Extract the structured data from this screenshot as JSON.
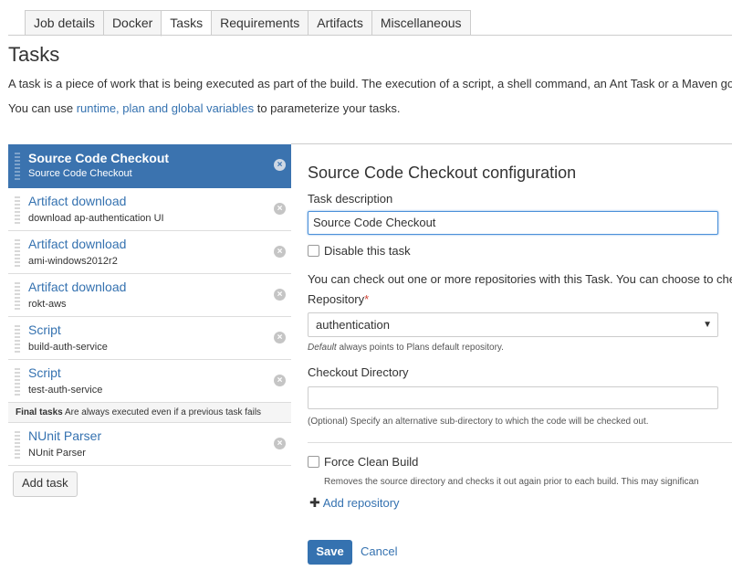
{
  "tabs": [
    "Job details",
    "Docker",
    "Tasks",
    "Requirements",
    "Artifacts",
    "Miscellaneous"
  ],
  "active_tab": "Tasks",
  "page_title": "Tasks",
  "intro": {
    "line1": "A task is a piece of work that is being executed as part of the build. The execution of a script, a shell command, an Ant Task or a Maven goal a",
    "line2_prefix": "You can use ",
    "line2_link": "runtime, plan and global variables",
    "line2_suffix": " to parameterize your tasks."
  },
  "tasks": [
    {
      "name": "Source Code Checkout",
      "detail": "Source Code Checkout"
    },
    {
      "name": "Artifact download",
      "detail": "download ap-authentication UI"
    },
    {
      "name": "Artifact download",
      "detail": "ami-windows2012r2"
    },
    {
      "name": "Artifact download",
      "detail": "rokt-aws"
    },
    {
      "name": "Script",
      "detail": "build-auth-service"
    },
    {
      "name": "Script",
      "detail": "test-auth-service"
    }
  ],
  "final_tasks": {
    "label": "Final tasks",
    "note": "Are always executed even if a previous task fails",
    "items": [
      {
        "name": "NUnit Parser",
        "detail": "NUnit Parser"
      }
    ]
  },
  "remove_glyph": "×",
  "add_task_label": "Add task",
  "config": {
    "title": "Source Code Checkout configuration",
    "task_description_label": "Task description",
    "task_description_value": "Source Code Checkout",
    "disable_label": "Disable this task",
    "checkout_note": "You can check out one or more repositories with this Task. You can choose to check",
    "repository_label": "Repository",
    "required_mark": "*",
    "repository_value": "authentication",
    "repository_hint_em": "Default",
    "repository_hint_rest": " always points to Plans default repository.",
    "checkout_dir_label": "Checkout Directory",
    "checkout_dir_value": "",
    "checkout_dir_hint": "(Optional) Specify an alternative sub-directory to which the code will be checked out.",
    "force_clean_label": "Force Clean Build",
    "force_clean_hint": "Removes the source directory and checks it out again prior to each build. This may significan",
    "add_repository": "Add repository",
    "save": "Save",
    "cancel": "Cancel"
  },
  "icons": {
    "remove": "remove-circle-icon",
    "grip": "drag-handle-icon",
    "add": "plus-icon",
    "dropdown": "caret-down-icon"
  },
  "colors": {
    "accent": "#3572b0",
    "selected_bg": "#3b73af",
    "required": "#d04437"
  }
}
